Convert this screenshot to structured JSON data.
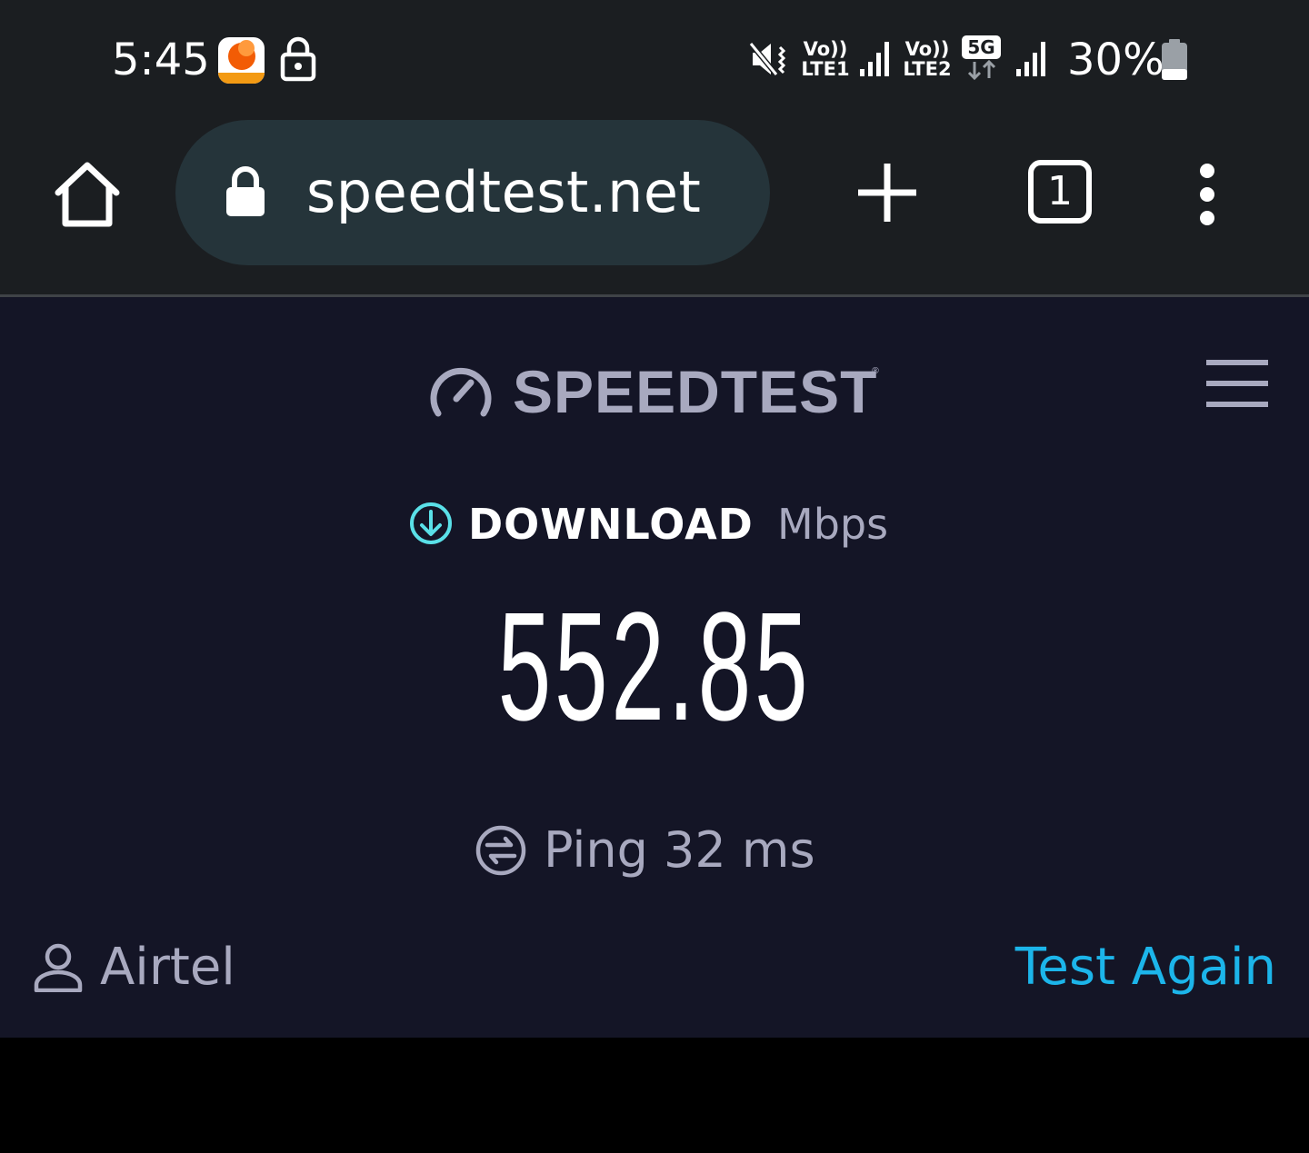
{
  "status_bar": {
    "time": "5:45",
    "notification_icons": [
      "app-notification-icon",
      "lock-icon"
    ],
    "sim1_label": "Vo))",
    "sim1_sub": "LTE1",
    "sim2_label": "Vo))",
    "sim2_sub": "LTE2",
    "network_badge": "5G",
    "battery_percent": "30%",
    "battery_level": 0.3
  },
  "browser": {
    "url": "speedtest.net",
    "tab_count": "1",
    "icons": {
      "home": "home-icon",
      "secure": "lock-icon",
      "new_tab": "plus-icon",
      "tabs": "tab-switcher-icon",
      "menu": "vertical-dots-icon"
    }
  },
  "speedtest": {
    "brand": "SPEEDTEST",
    "brand_mark": "®",
    "download_label": "DOWNLOAD",
    "download_unit": "Mbps",
    "download_value": "552.85",
    "ping_text": "Ping 32 ms",
    "isp": "Airtel",
    "test_again_label": "Test Again"
  },
  "colors": {
    "status_bg": "#1b1e21",
    "omnibox_bg": "#25343a",
    "page_bg": "#141526",
    "muted_text": "#a8a9bf",
    "accent_cyan": "#5ae0e8",
    "link_blue": "#1cb5ea"
  }
}
